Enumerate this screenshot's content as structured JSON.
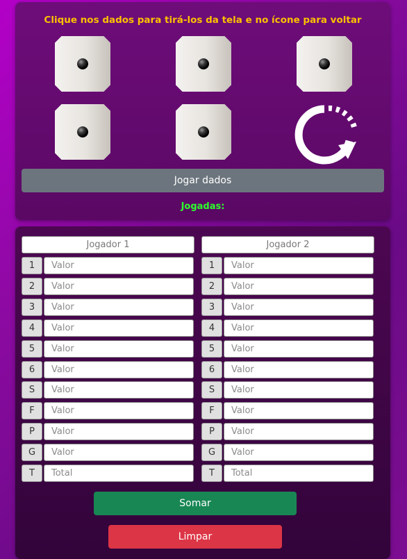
{
  "instruction": "Clique nos dados para tirá-los da tela e no ícone para voltar",
  "dice": [
    {
      "icon": "die-face-1-icon"
    },
    {
      "icon": "die-face-1-icon"
    },
    {
      "icon": "die-face-1-icon"
    },
    {
      "icon": "die-face-1-icon"
    },
    {
      "icon": "die-face-1-icon"
    }
  ],
  "reset_icon": "rotate-clockwise-icon",
  "roll_button": "Jogar dados",
  "plays_label": "Jogadas:",
  "players": [
    {
      "name": "Jogador 1",
      "rows": [
        {
          "tag": "1",
          "placeholder": "Valor"
        },
        {
          "tag": "2",
          "placeholder": "Valor"
        },
        {
          "tag": "3",
          "placeholder": "Valor"
        },
        {
          "tag": "4",
          "placeholder": "Valor"
        },
        {
          "tag": "5",
          "placeholder": "Valor"
        },
        {
          "tag": "6",
          "placeholder": "Valor"
        },
        {
          "tag": "S",
          "placeholder": "Valor"
        },
        {
          "tag": "F",
          "placeholder": "Valor"
        },
        {
          "tag": "P",
          "placeholder": "Valor"
        },
        {
          "tag": "G",
          "placeholder": "Valor"
        },
        {
          "tag": "T",
          "placeholder": "Total"
        }
      ]
    },
    {
      "name": "Jogador 2",
      "rows": [
        {
          "tag": "1",
          "placeholder": "Valor"
        },
        {
          "tag": "2",
          "placeholder": "Valor"
        },
        {
          "tag": "3",
          "placeholder": "Valor"
        },
        {
          "tag": "4",
          "placeholder": "Valor"
        },
        {
          "tag": "5",
          "placeholder": "Valor"
        },
        {
          "tag": "6",
          "placeholder": "Valor"
        },
        {
          "tag": "S",
          "placeholder": "Valor"
        },
        {
          "tag": "F",
          "placeholder": "Valor"
        },
        {
          "tag": "P",
          "placeholder": "Valor"
        },
        {
          "tag": "G",
          "placeholder": "Valor"
        },
        {
          "tag": "T",
          "placeholder": "Total"
        }
      ]
    }
  ],
  "sum_button": "Somar",
  "clear_button": "Limpar",
  "colors": {
    "instruction": "#ffc000",
    "plays_label": "#2cff2c",
    "roll_button": "#6c757d",
    "sum_button": "#198754",
    "clear_button": "#dc3545"
  }
}
